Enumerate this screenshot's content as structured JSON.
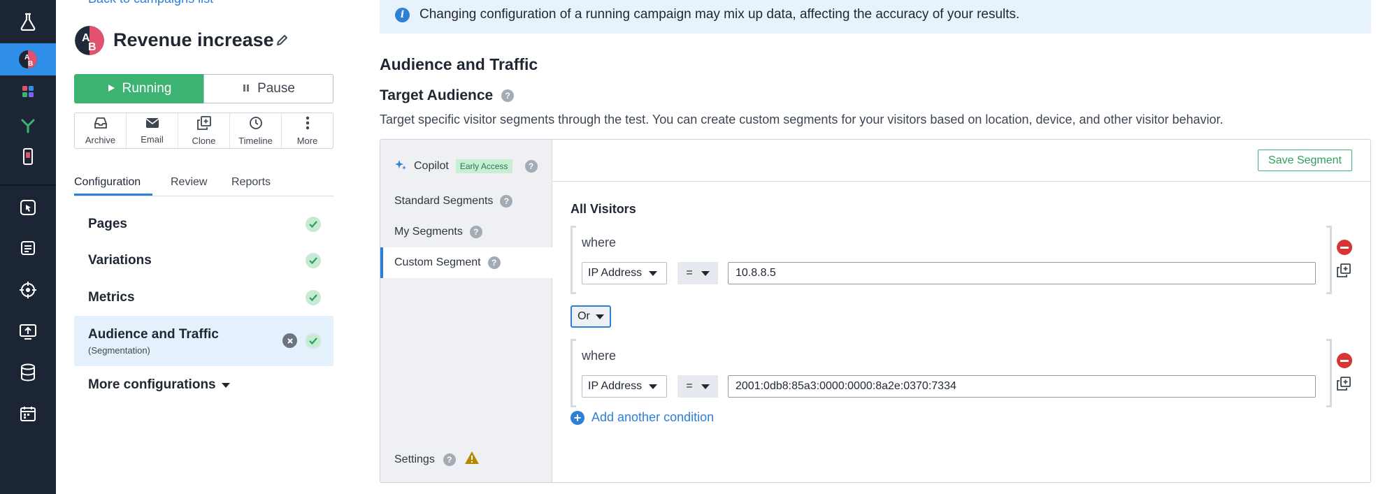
{
  "rail": {
    "items": [
      {
        "name": "experiments-icon",
        "active": false
      },
      {
        "name": "ab-test-icon",
        "active": true
      },
      {
        "name": "apps-icon",
        "active": false
      },
      {
        "name": "funnel-icon",
        "active": false
      },
      {
        "name": "mobile-icon",
        "active": false
      },
      {
        "name": "cursor-click-icon",
        "active": false
      },
      {
        "name": "list-icon",
        "active": false
      },
      {
        "name": "crosshair-icon",
        "active": false
      },
      {
        "name": "screen-share-icon",
        "active": false
      },
      {
        "name": "database-icon",
        "active": false
      },
      {
        "name": "calendar-icon",
        "active": false
      }
    ]
  },
  "panel": {
    "back_link": "Back to campaigns list",
    "campaign_title": "Revenue increase",
    "running_label": "Running",
    "pause_label": "Pause",
    "actions": [
      {
        "label": "Archive",
        "icon": "archive-icon"
      },
      {
        "label": "Email",
        "icon": "email-icon"
      },
      {
        "label": "Clone",
        "icon": "clone-icon"
      },
      {
        "label": "Timeline",
        "icon": "timeline-icon"
      },
      {
        "label": "More",
        "icon": "more-icon"
      }
    ],
    "tabs": [
      "Configuration",
      "Review",
      "Reports"
    ],
    "nav": [
      {
        "label": "Pages"
      },
      {
        "label": "Variations"
      },
      {
        "label": "Metrics"
      },
      {
        "label": "Audience and Traffic",
        "sub": "(Segmentation)"
      }
    ],
    "more_configurations": "More configurations"
  },
  "main": {
    "banner": "Changing configuration of a running campaign may mix up data, affecting the accuracy of your results.",
    "section_title": "Audience and Traffic",
    "target_title": "Target Audience",
    "target_desc": "Target specific visitor segments through the test. You can create custom segments for your visitors based on location, device, and other visitor behavior.",
    "segments": {
      "copilot": "Copilot",
      "early_access": "Early Access",
      "standard": "Standard Segments",
      "my": "My Segments",
      "custom": "Custom Segment",
      "settings": "Settings"
    },
    "save_segment": "Save Segment",
    "all_visitors": "All Visitors",
    "conditions": [
      {
        "where": "where",
        "field": "IP Address",
        "operator": "=",
        "value": "10.8.8.5"
      },
      {
        "where": "where",
        "field": "IP Address",
        "operator": "=",
        "value": "2001:0db8:85a3:0000:0000:8a2e:0370:7334"
      }
    ],
    "logic": "Or",
    "add_condition": "Add another condition"
  },
  "colors": {
    "rail_bg": "#1b2533",
    "accent": "#2e7fd6",
    "running": "#3cb371",
    "remove": "#d93434",
    "warning": "#b58900"
  }
}
